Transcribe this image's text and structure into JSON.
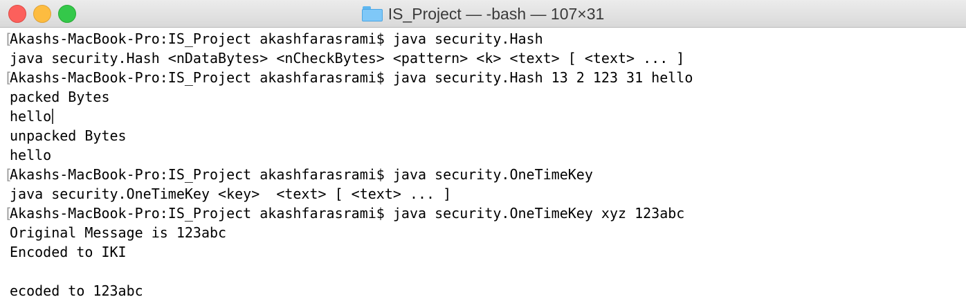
{
  "window": {
    "title": "IS_Project — -bash — 107×31"
  },
  "terminal": {
    "lines": [
      {
        "mark": "[",
        "text": "Akashs-MacBook-Pro:IS_Project akashfarasrami$ java security.Hash"
      },
      {
        "mark": "",
        "text": "java security.Hash <nDataBytes> <nCheckBytes> <pattern> <k> <text> [ <text> ... ]"
      },
      {
        "mark": "[",
        "text": "Akashs-MacBook-Pro:IS_Project akashfarasrami$ java security.Hash 13 2 123 31 hello"
      },
      {
        "mark": "",
        "text": "packed Bytes"
      },
      {
        "mark": "",
        "text": "hello"
      },
      {
        "mark": "",
        "text": "unpacked Bytes"
      },
      {
        "mark": "",
        "text": "hello"
      },
      {
        "mark": "[",
        "text": "Akashs-MacBook-Pro:IS_Project akashfarasrami$ java security.OneTimeKey"
      },
      {
        "mark": "",
        "text": "java security.OneTimeKey <key>  <text> [ <text> ... ]"
      },
      {
        "mark": "[",
        "text": "Akashs-MacBook-Pro:IS_Project akashfarasrami$ java security.OneTimeKey xyz 123abc"
      },
      {
        "mark": "",
        "text": "Original Message is 123abc"
      },
      {
        "mark": "",
        "text": "Encoded to IKI"
      },
      {
        "mark": "",
        "text": ""
      },
      {
        "mark": "",
        "text": "ecoded to 123abc"
      }
    ]
  }
}
